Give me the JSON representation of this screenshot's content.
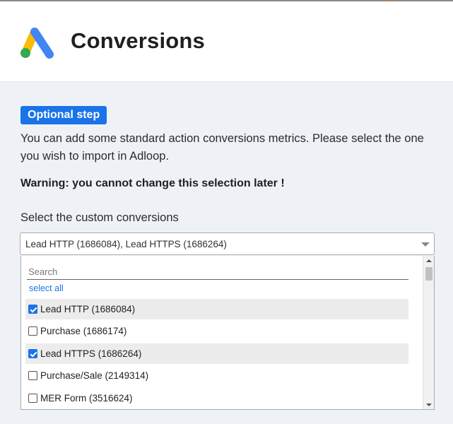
{
  "header": {
    "title": "Conversions",
    "logo_icon": "google-ads-logo",
    "accent_color": "#e8710a"
  },
  "badge": {
    "text": "Optional step",
    "color": "#1a73e8"
  },
  "description": "You can add some standard action conversions metrics. Please select the one you wish to import in Adloop.",
  "warning": "Warning: you cannot change this selection later !",
  "select": {
    "label": "Select the custom conversions",
    "value": "Lead HTTP (1686084), Lead HTTPS (1686264)",
    "search_placeholder": "Search",
    "search_value": "",
    "select_all_label": "select all",
    "options": [
      {
        "label": "Lead HTTP (1686084)",
        "checked": true
      },
      {
        "label": "Purchase (1686174)",
        "checked": false
      },
      {
        "label": "Lead HTTPS (1686264)",
        "checked": true
      },
      {
        "label": "Purchase/Sale (2149314)",
        "checked": false
      },
      {
        "label": "MER Form (3516624)",
        "checked": false
      }
    ],
    "scroll_position": 0
  }
}
